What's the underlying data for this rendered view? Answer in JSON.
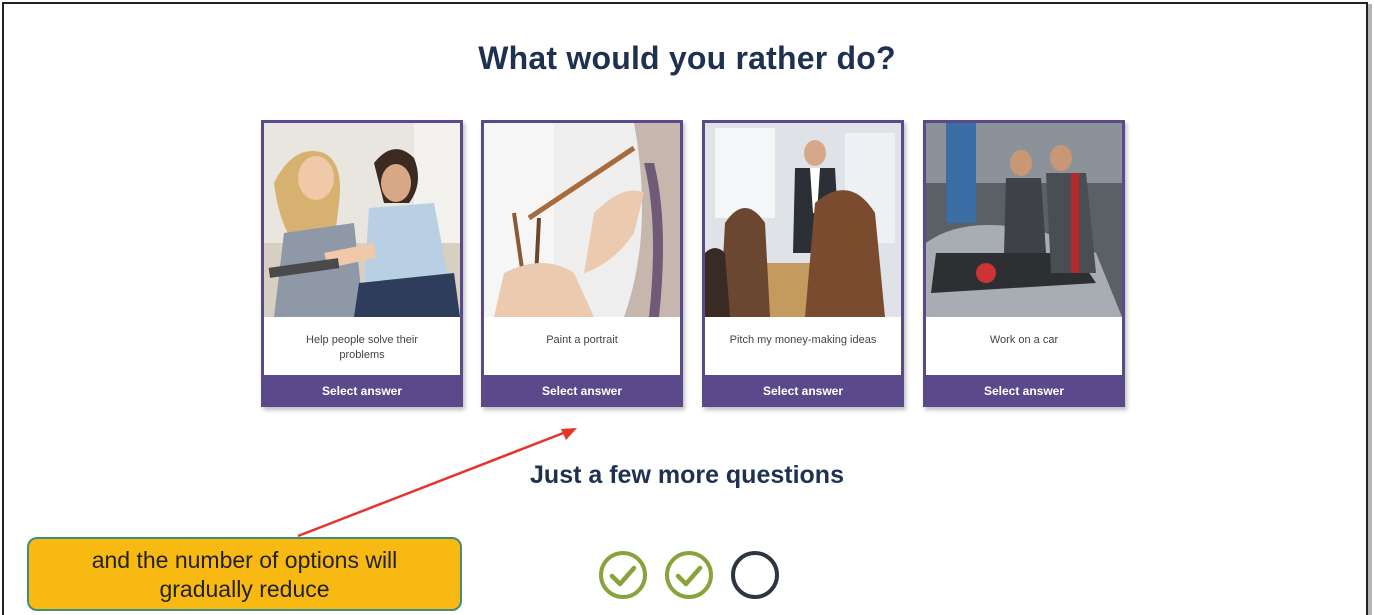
{
  "page": {
    "title": "What would you rather do?",
    "subtitle": "Just a few more questions"
  },
  "options": [
    {
      "label": "Help people solve their problems",
      "button": "Select answer",
      "image": "counseling-photo"
    },
    {
      "label": "Paint a portrait",
      "button": "Select answer",
      "image": "painting-photo"
    },
    {
      "label": "Pitch my money-making ideas",
      "button": "Select answer",
      "image": "presentation-photo"
    },
    {
      "label": "Work on a car",
      "button": "Select answer",
      "image": "mechanics-photo"
    }
  ],
  "progress": [
    {
      "state": "complete",
      "icon": "check-circle-icon"
    },
    {
      "state": "complete",
      "icon": "check-circle-icon"
    },
    {
      "state": "current",
      "icon": "empty-circle-icon"
    }
  ],
  "annotation": {
    "text_line1": "and the number of options will",
    "text_line2": "gradually reduce"
  },
  "colors": {
    "heading": "#1f3150",
    "card_purple": "#5b4a8b",
    "check_green": "#8aa23a",
    "callout_fill": "#f7b912",
    "callout_border": "#3f8f7a",
    "arrow_red": "#e5352b"
  }
}
